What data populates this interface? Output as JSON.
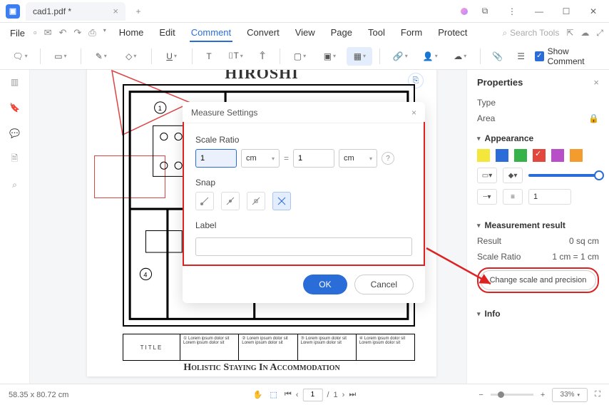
{
  "titlebar": {
    "tab_name": "cad1.pdf *"
  },
  "menu": {
    "file": "File",
    "tabs": [
      "Home",
      "Edit",
      "Comment",
      "Convert",
      "View",
      "Page",
      "Tool",
      "Form",
      "Protect"
    ],
    "active_tab": "Comment",
    "search_placeholder": "Search Tools"
  },
  "toolbar": {
    "show_comment": "Show Comment"
  },
  "page": {
    "title": "HIROSHI",
    "bottom_title": "Holistic Staying In Accommodation",
    "titleblock_heading": "TITLE",
    "lorem": "Lorem ipsum dolor sit"
  },
  "dialog": {
    "title": "Measure Settings",
    "scale_label": "Scale Ratio",
    "left_value": "1",
    "left_unit": "cm",
    "right_value": "1",
    "right_unit": "cm",
    "snap_label": "Snap",
    "label_label": "Label",
    "ok": "OK",
    "cancel": "Cancel"
  },
  "panel": {
    "title": "Properties",
    "type_label": "Type",
    "type_value": "Area",
    "appearance": "Appearance",
    "colors": [
      "#f5e63c",
      "#2b6dd8",
      "#35b24a",
      "#e2473d",
      "#b84fc9",
      "#f39b2c"
    ],
    "selected_color_index": 3,
    "thickness_value": "1",
    "measurement_heading": "Measurement result",
    "result_label": "Result",
    "result_value": "0 sq cm",
    "scale_ratio_label": "Scale Ratio",
    "scale_ratio_value": "1 cm = 1 cm",
    "change_btn": "Change scale and precision",
    "info": "Info"
  },
  "status": {
    "coords": "58.35 x 80.72 cm",
    "page_current": "1",
    "page_total": "1",
    "zoom": "33%"
  }
}
